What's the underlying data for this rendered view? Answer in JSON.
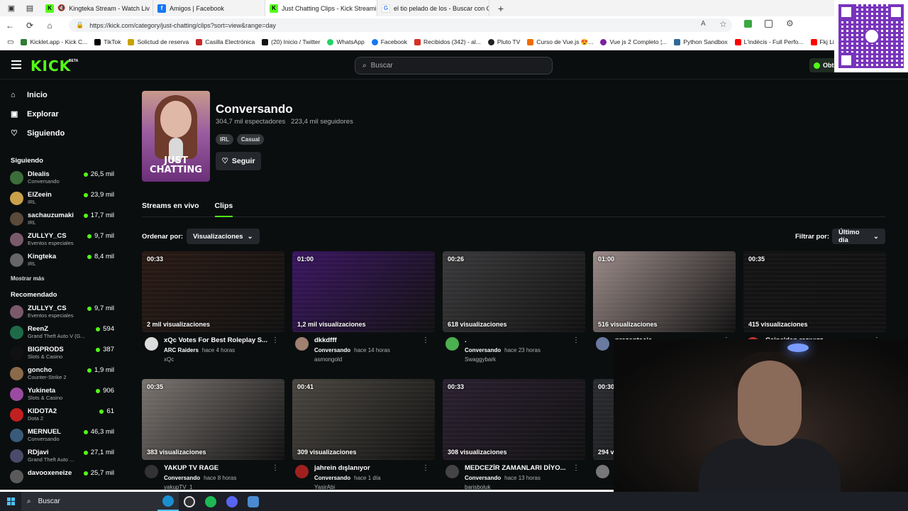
{
  "browser": {
    "tabs": [
      {
        "title": "Kingteka Stream - Watch Liv",
        "fav_color": "#53fc18",
        "fav_text": "K",
        "muted": true
      },
      {
        "title": "Amigos | Facebook",
        "fav_color": "#1877f2",
        "fav_text": "f"
      },
      {
        "title": "Just Chatting Clips - Kick Streamin",
        "fav_color": "#53fc18",
        "fav_text": "K",
        "active": true
      },
      {
        "title": "el tio pelado de los - Buscar con G",
        "fav_color": "#ffffff",
        "fav_text": "G"
      }
    ],
    "new_tab": "+",
    "url": "https://kick.com/category/just-chatting/clips?sort=view&range=day",
    "bookmarks": [
      {
        "label": "Kicklet.app - Kick C...",
        "color": "#2e7d32"
      },
      {
        "label": "TikTok",
        "color": "#000000"
      },
      {
        "label": "Solictud de reserva",
        "color": "#c8a200"
      },
      {
        "label": "Casilla Electrónica",
        "color": "#c62828"
      },
      {
        "label": "(20) Inicio / Twitter",
        "color": "#111111"
      },
      {
        "label": "WhatsApp",
        "color": "#25d366"
      },
      {
        "label": "Facebook",
        "color": "#1877f2"
      },
      {
        "label": "Recibidos (342) - al...",
        "color": "#d93025"
      },
      {
        "label": "Pluto TV",
        "color": "#222222"
      },
      {
        "label": "Curso de Vue.js 😍...",
        "color": "#ef6c00"
      },
      {
        "label": "Vue js 2 Completo ¦...",
        "color": "#7b1fa2"
      },
      {
        "label": "Python Sandbox",
        "color": "#306998"
      },
      {
        "label": "L'indécis - Full Perfo...",
        "color": "#ff0000"
      },
      {
        "label": "Fkj Live",
        "color": "#ff0000"
      }
    ]
  },
  "header": {
    "logo": "KICK",
    "beta": "BETA",
    "search_placeholder": "Buscar",
    "cta": "Obt"
  },
  "sidebar": {
    "nav": [
      {
        "label": "Inicio",
        "icon": "⌂"
      },
      {
        "label": "Explorar",
        "icon": "▣"
      },
      {
        "label": "Siguiendo",
        "icon": "♡"
      }
    ],
    "following_title": "Siguiendo",
    "following": [
      {
        "name": "Dlealis",
        "category": "Conversando",
        "viewers": "26,5 mil",
        "color": "#3c6e3a"
      },
      {
        "name": "ElZeein",
        "category": "IRL",
        "viewers": "23,9 mil",
        "color": "#c9a14a"
      },
      {
        "name": "sachauzumaki",
        "category": "IRL",
        "viewers": "17,7 mil",
        "color": "#5a4a3a"
      },
      {
        "name": "ZULLYY_CS",
        "category": "Eventos especiales",
        "viewers": "9,7 mil",
        "color": "#7a5a6a"
      },
      {
        "name": "Kingteka",
        "category": "IRL",
        "viewers": "8,4 mil",
        "color": "#666666"
      }
    ],
    "show_more": "Mostrar más",
    "recommended_title": "Recomendado",
    "recommended": [
      {
        "name": "ZULLYY_CS",
        "category": "Eventos especiales",
        "viewers": "9,7 mil",
        "color": "#7a5a6a"
      },
      {
        "name": "ReenZ",
        "category": "Grand Theft Auto V (G...",
        "viewers": "594",
        "color": "#1e6b4a"
      },
      {
        "name": "BIGPRODS",
        "category": "Slots & Casino",
        "viewers": "387",
        "color": "#111111"
      },
      {
        "name": "goncho",
        "category": "Counter-Strike 2",
        "viewers": "1,9 mil",
        "color": "#8a6a4a"
      },
      {
        "name": "Yukineta",
        "category": "Slots & Casino",
        "viewers": "906",
        "color": "#9a4aa0"
      },
      {
        "name": "KIDOTA2",
        "category": "Dota 2",
        "viewers": "61",
        "color": "#c02020"
      },
      {
        "name": "MERNUEL",
        "category": "Conversando",
        "viewers": "46,3 mil",
        "color": "#3a5a7a"
      },
      {
        "name": "RDjavi",
        "category": "Grand Theft Auto ...",
        "viewers": "27,1 mil",
        "color": "#4a4a6a"
      },
      {
        "name": "davooxeneize",
        "category": "",
        "viewers": "25,7 mil",
        "color": "#5a5a5a"
      }
    ]
  },
  "category": {
    "title": "Conversando",
    "viewers": "304,7 mil espectadores",
    "followers": "223,4 mil seguidores",
    "tags": [
      "IRL",
      "Casual"
    ],
    "follow": "Seguir",
    "image_text_1": "JUST",
    "image_text_2": "CHATTING"
  },
  "content_tabs": [
    "Streams en vivo",
    "Clips"
  ],
  "sort": {
    "label": "Ordenar por:",
    "value": "Visualizaciones",
    "filter_label": "Filtrar por:",
    "filter_value": "Último día"
  },
  "clips": [
    {
      "duration": "00:33",
      "views": "2 mil visualizaciones",
      "title": "xQc Votes For Best Roleplay S...",
      "category": "ARC Raiders",
      "time": "hace 4 horas",
      "author": "xQc",
      "bg": "#2a1a14",
      "av": "#dddddd"
    },
    {
      "duration": "01:00",
      "views": "1,2 mil visualizaciones",
      "title": "dkkdfff",
      "category": "Conversando",
      "time": "hace 14 horas",
      "author": "asmongold",
      "bg": "#3a1660",
      "av": "#a08070"
    },
    {
      "duration": "00:26",
      "views": "618 visualizaciones",
      "title": ".",
      "category": "Conversando",
      "time": "hace 23 horas",
      "author": "Swaggybark",
      "bg": "#3a3a3c",
      "av": "#4caf50"
    },
    {
      "duration": "01:00",
      "views": "516 visualizaciones",
      "title": "prezentacja",
      "category": "",
      "time": "",
      "author": "",
      "bg": "#9a8a88",
      "av": "#6a7aa0"
    },
    {
      "duration": "00:35",
      "views": "415 visualizaciones",
      "title": "Caine'den razıyızz",
      "category": "",
      "time": "",
      "author": "",
      "bg": "#141414",
      "av": "#c03030"
    },
    {
      "duration": "00:35",
      "views": "383 visualizaciones",
      "title": "YAKUP TV RAGE",
      "category": "Conversando",
      "time": "hace 8 horas",
      "author": "yakupTV_1",
      "bg": "#7a7470",
      "av": "#333333"
    },
    {
      "duration": "00:41",
      "views": "309 visualizaciones",
      "title": "jahrein dışlanıyor",
      "category": "Conversando",
      "time": "hace 1 día",
      "author": "YasirAbi",
      "bg": "#4a4640",
      "av": "#a02020"
    },
    {
      "duration": "00:33",
      "views": "308 visualizaciones",
      "title": "MEDCEZİR ZAMANLARI DİYO...",
      "category": "Conversando",
      "time": "hace 13 horas",
      "author": "barisboluk",
      "bg": "#2a2030",
      "av": "#444444"
    },
    {
      "duration": "00:30",
      "views": "294 v",
      "title": "",
      "category": "",
      "time": "",
      "author": "",
      "bg": "#2a2c30",
      "av": "#777777"
    }
  ],
  "taskbar": {
    "search": "Buscar",
    "apps": [
      {
        "name": "edge",
        "color": "#1a8fd0",
        "active": true
      },
      {
        "name": "obs",
        "color": "#302e31"
      },
      {
        "name": "spotify",
        "color": "#1db954"
      },
      {
        "name": "discord",
        "color": "#5865f2"
      },
      {
        "name": "calculator",
        "color": "#4a8ad0"
      }
    ]
  }
}
